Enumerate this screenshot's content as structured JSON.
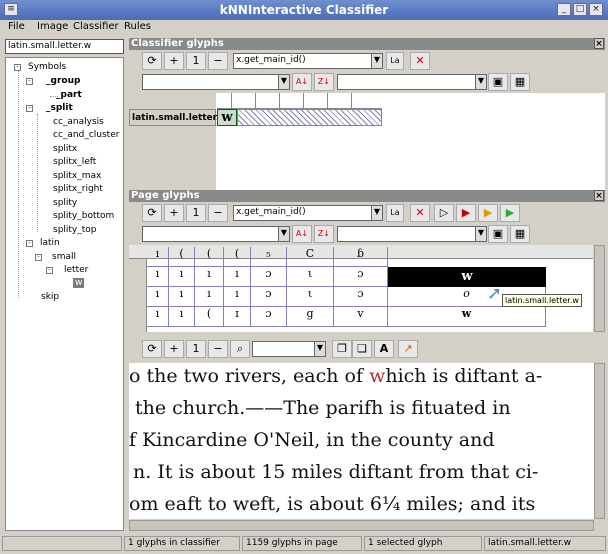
{
  "window": {
    "title": "kNNInteractive Classifier"
  },
  "menu": [
    "File",
    "Image",
    "Classifier",
    "Rules"
  ],
  "search": {
    "value": "latin.small.letter.w"
  },
  "tree": {
    "root": "Symbols",
    "group": "_group",
    "part": "_part",
    "split": "_split",
    "split_items": [
      "cc_analysis",
      "cc_and_cluster",
      "splitx",
      "splitx_left",
      "splitx_max",
      "splitx_right",
      "splity",
      "splity_bottom",
      "splity_top"
    ],
    "latin": "latin",
    "small": "small",
    "letter": "letter",
    "w": "w",
    "skip": "skip"
  },
  "classifier_panel": {
    "title": "Classifier glyphs",
    "feature_combo": "x.get_main_id()",
    "la_button": "La",
    "row_label": "latin.small.letter.w",
    "glyph": "w"
  },
  "page_panel": {
    "title": "Page glyphs",
    "feature_combo": "x.get_main_id()",
    "la_button": "La",
    "tooltip": "latin.small.letter.w",
    "selected_glyph": "w",
    "rows": [
      [
        "ı",
        "(",
        "(",
        "(",
        "₅",
        "C",
        "ɓ"
      ],
      [
        "ı",
        "ı",
        "ı",
        "ı",
        "ɔ",
        "ι",
        "ɔ"
      ],
      [
        "ı",
        "ı",
        "ı",
        "ı",
        "ɔ",
        "ι",
        "ɔ"
      ],
      [
        "ı",
        "ı",
        "(",
        "ɪ",
        "ɔ",
        "g",
        "v"
      ]
    ],
    "row_last": [
      "o",
      "w"
    ]
  },
  "document": {
    "lines": [
      "o the two rivers, each of which is diftant a-",
      "the church.——The parifh is fituated in",
      "f Kincardine O'Neil, in the county and",
      "n. It is about 15 miles diftant from that ci-",
      "om eaft to weft, is about 6¼ miles; and its"
    ],
    "highlight_word": "w",
    "highlight_color": "#c0282a"
  },
  "status": {
    "classifier_count": "1 glyphs in classifier",
    "page_count": "1159 glyphs in page",
    "selected": "1 selected glyph",
    "selected_name": "latin.small.letter.w"
  }
}
